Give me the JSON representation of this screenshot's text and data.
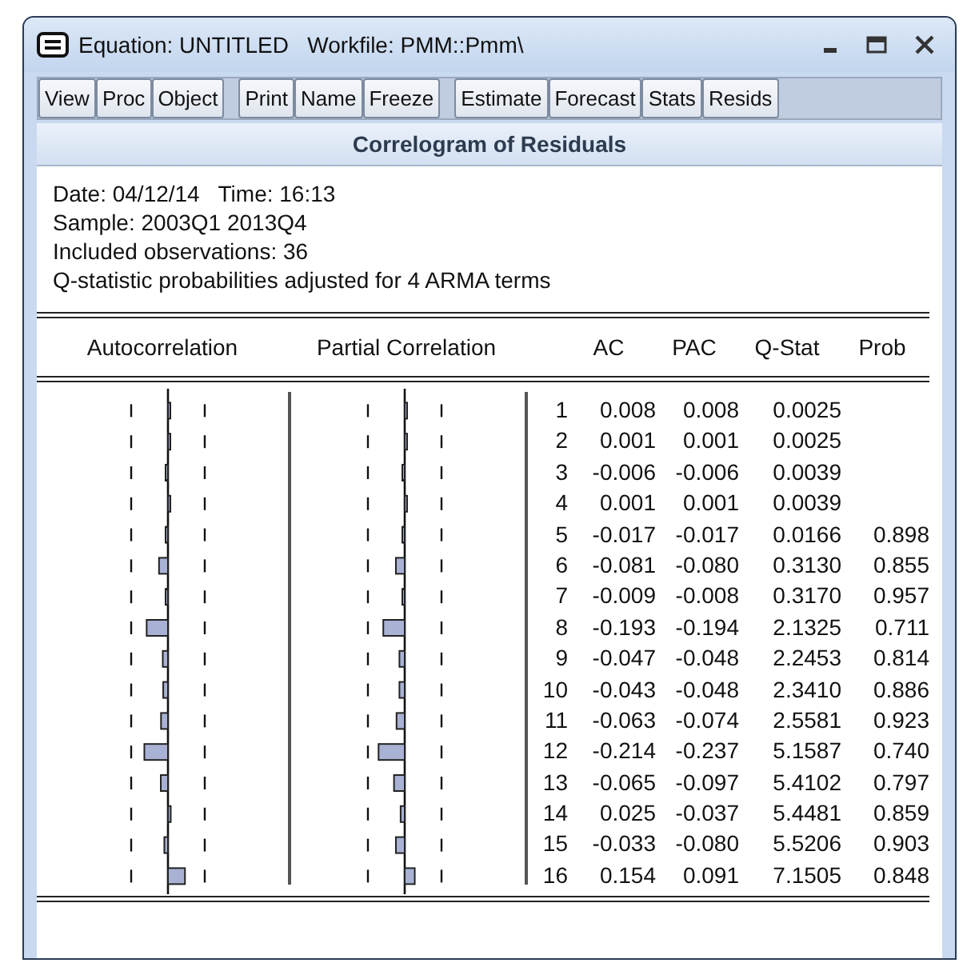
{
  "window": {
    "title": "Equation: UNTITLED   Workfile: PMM::Pmm\\"
  },
  "toolbar": [
    [
      "View",
      "Proc",
      "Object"
    ],
    [
      "Print",
      "Name",
      "Freeze"
    ],
    [
      "Estimate",
      "Forecast",
      "Stats",
      "Resids"
    ]
  ],
  "heading": "Correlogram of Residuals",
  "info": [
    "Date: 04/12/14   Time: 16:13",
    "Sample: 2003Q1 2013Q4",
    "Included observations: 36",
    "Q-statistic probabilities adjusted for 4 ARMA terms"
  ],
  "columns": [
    "Autocorrelation",
    "Partial Correlation",
    "AC",
    "PAC",
    "Q-Stat",
    "Prob"
  ],
  "rows": [
    {
      "lag": "1",
      "ac": "0.008",
      "pac": "0.008",
      "qstat": "0.0025"
    },
    {
      "lag": "2",
      "ac": "0.001",
      "pac": "0.001",
      "qstat": "0.0025"
    },
    {
      "lag": "3",
      "ac": "-0.006",
      "pac": "-0.006",
      "qstat": "0.0039"
    },
    {
      "lag": "4",
      "ac": "0.001",
      "pac": "0.001",
      "qstat": "0.0039"
    },
    {
      "lag": "5",
      "ac": "-0.017",
      "pac": "-0.017",
      "qstat": "0.0166",
      "prob": "0.898"
    },
    {
      "lag": "6",
      "ac": "-0.081",
      "pac": "-0.080",
      "qstat": "0.3130",
      "prob": "0.855"
    },
    {
      "lag": "7",
      "ac": "-0.009",
      "pac": "-0.008",
      "qstat": "0.3170",
      "prob": "0.957"
    },
    {
      "lag": "8",
      "ac": "-0.193",
      "pac": "-0.194",
      "qstat": "2.1325",
      "prob": "0.711"
    },
    {
      "lag": "9",
      "ac": "-0.047",
      "pac": "-0.048",
      "qstat": "2.2453",
      "prob": "0.814"
    },
    {
      "lag": "10",
      "ac": "-0.043",
      "pac": "-0.048",
      "qstat": "2.3410",
      "prob": "0.886"
    },
    {
      "lag": "11",
      "ac": "-0.063",
      "pac": "-0.074",
      "qstat": "2.5581",
      "prob": "0.923"
    },
    {
      "lag": "12",
      "ac": "-0.214",
      "pac": "-0.237",
      "qstat": "5.1587",
      "prob": "0.740"
    },
    {
      "lag": "13",
      "ac": "-0.065",
      "pac": "-0.097",
      "qstat": "5.4102",
      "prob": "0.797"
    },
    {
      "lag": "14",
      "ac": "0.025",
      "pac": "-0.037",
      "qstat": "5.4481",
      "prob": "0.859"
    },
    {
      "lag": "15",
      "ac": "-0.033",
      "pac": "-0.080",
      "qstat": "5.5206",
      "prob": "0.903"
    },
    {
      "lag": "16",
      "ac": "0.154",
      "pac": "0.091",
      "qstat": "7.1505",
      "prob": "0.848"
    }
  ]
}
